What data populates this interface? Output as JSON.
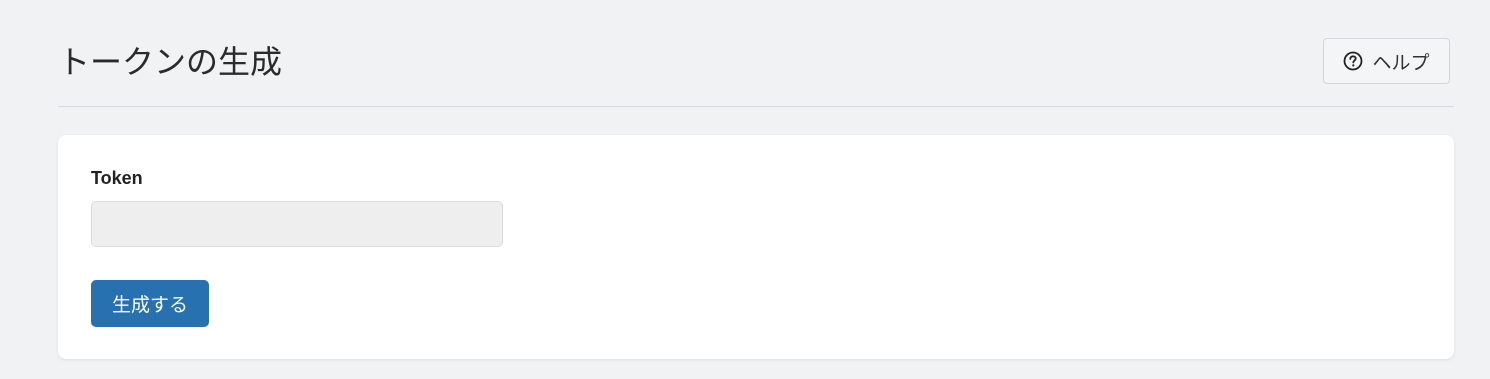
{
  "header": {
    "title": "トークンの生成",
    "help_label": "ヘルプ",
    "help_icon": "question-circle-icon"
  },
  "form": {
    "token_label": "Token",
    "token_value": "",
    "token_placeholder": "",
    "generate_label": "生成する"
  },
  "colors": {
    "primary": "#2771b0",
    "background": "#f1f2f4",
    "card": "#ffffff",
    "input_disabled": "#eeeeee"
  }
}
